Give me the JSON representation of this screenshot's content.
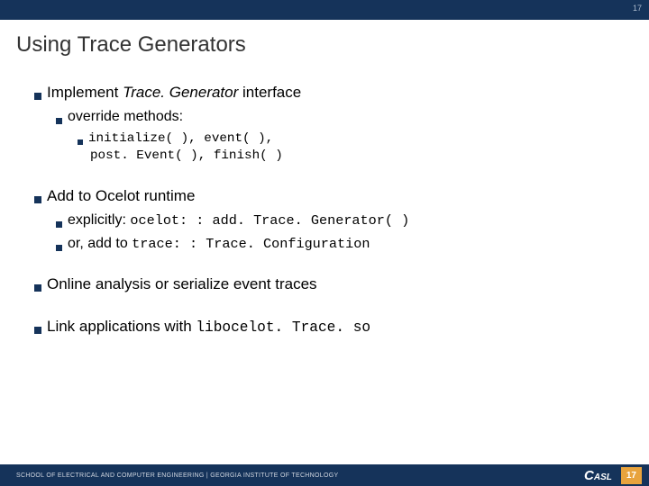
{
  "topbar": {
    "pagenum_small": "17"
  },
  "title": "Using Trace Generators",
  "b1": {
    "pre": "Implement ",
    "ital": "Trace. Generator",
    "post": " interface",
    "sub1": {
      "text": "override methods:",
      "code_l1": "initialize( ), event( ),",
      "code_l2": "post. Event( ), finish( )"
    }
  },
  "b2": {
    "text": "Add to Ocelot runtime",
    "sub1_pre": "explicitly: ",
    "sub1_code": "ocelot: : add. Trace. Generator( )",
    "sub2_pre": "or, add to ",
    "sub2_code": "trace: : Trace. Configuration"
  },
  "b3": {
    "text": "Online analysis or serialize event traces"
  },
  "b4": {
    "pre": "Link applications with ",
    "code": "libocelot. Trace. so"
  },
  "footer": {
    "left": "SCHOOL OF ELECTRICAL AND COMPUTER ENGINEERING | GEORGIA INSTITUTE OF TECHNOLOGY",
    "logo_c": "C",
    "logo_rest": "ASL",
    "pagenum": "17"
  }
}
